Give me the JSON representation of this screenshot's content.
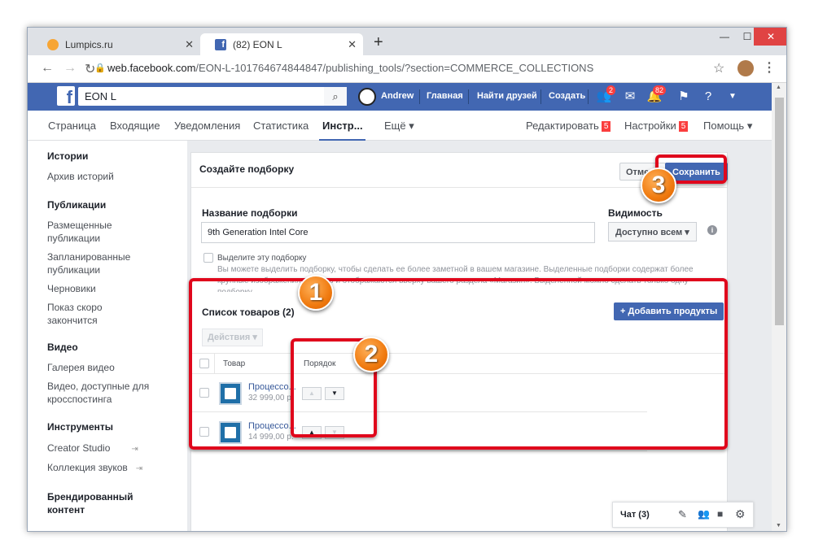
{
  "browser": {
    "tabs": [
      {
        "title": "Lumpics.ru",
        "active": false,
        "icon": "orange-circle-icon"
      },
      {
        "title": "(82) EON L",
        "active": true,
        "icon": "facebook-icon"
      }
    ],
    "url_host": "web.facebook.com",
    "url_path": "/EON-L-101764674844847/publishing_tools/?section=COMMERCE_COLLECTIONS"
  },
  "fb": {
    "search_value": "EON L",
    "user": "Andrew",
    "nav": [
      "Главная",
      "Найти друзей",
      "Создать"
    ],
    "badges": {
      "friends": "2",
      "notifications": "82"
    }
  },
  "page_nav": {
    "items": [
      "Страница",
      "Входящие",
      "Уведомления",
      "Статистика",
      "Инстр...",
      "Ещё ▾"
    ],
    "right": [
      {
        "label": "Редактировать",
        "badge": "5"
      },
      {
        "label": "Настройки",
        "badge": "5"
      },
      {
        "label": "Помощь ▾",
        "badge": ""
      }
    ]
  },
  "sidebar": {
    "stories_h": "Истории",
    "stories_items": [
      "Архив историй"
    ],
    "pubs_h": "Публикации",
    "pubs_items": [
      "Размещенные публикации",
      "Запланированные публикации",
      "Черновики",
      "Показ скоро закончится"
    ],
    "video_h": "Видео",
    "video_items": [
      "Галерея видео",
      "Видео, доступные для кросспостинга"
    ],
    "tools_h": "Инструменты",
    "tools_items": [
      "Creator Studio",
      "Коллекция звуков"
    ],
    "brand_h": "Брендированный контент"
  },
  "form": {
    "title": "Создайте подборку",
    "cancel": "Отмена",
    "save": "Сохранить",
    "name_label": "Название подборки",
    "name_value": "9th Generation Intel Core",
    "visibility_label": "Видимость",
    "visibility_value": "Доступно всем ▾",
    "highlight_label": "Выделите эту подборку",
    "highlight_desc": "Вы можете выделить подборку, чтобы сделать ее более заметной в вашем магазине. Выделенные подборки содержат более крупные изображения товаров и отображаются вверху вашего раздела «Магазин». Выделенной можно сделать только одну подборку."
  },
  "products": {
    "title": "Список товаров (2)",
    "add_button": "+ Добавить продукты",
    "actions": "Действия ▾",
    "col_product": "Товар",
    "col_order": "Порядок",
    "rows": [
      {
        "name": "Процессо...",
        "price": "32 999,00 р."
      },
      {
        "name": "Процессо...",
        "price": "14 999,00 р."
      }
    ]
  },
  "chat": {
    "label": "Чат (3)"
  },
  "annotations": [
    "1",
    "2",
    "3"
  ],
  "colors": {
    "fb_blue": "#4267b2",
    "highlight_red": "#e0071c",
    "badge_red": "#fa3e3e"
  }
}
